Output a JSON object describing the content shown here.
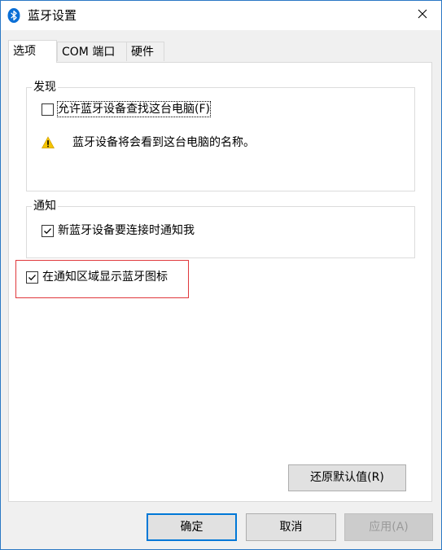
{
  "window": {
    "title": "蓝牙设置"
  },
  "tabs": [
    {
      "label": "选项",
      "active": true
    },
    {
      "label": "COM 端口",
      "active": false
    },
    {
      "label": "硬件",
      "active": false
    }
  ],
  "discovery": {
    "group_title": "发现",
    "allow_find_label": "允许蓝牙设备查找这台电脑(F)",
    "allow_find_checked": false,
    "warning_text": "蓝牙设备将会看到这台电脑的名称。"
  },
  "notifications": {
    "group_title": "通知",
    "notify_new_label": "新蓝牙设备要连接时通知我",
    "notify_new_checked": true
  },
  "show_icon": {
    "label": "在通知区域显示蓝牙图标",
    "checked": true
  },
  "buttons": {
    "restore_defaults": "还原默认值(R)",
    "ok": "确定",
    "cancel": "取消",
    "apply": "应用(A)"
  },
  "colors": {
    "accent": "#0078d7",
    "highlight": "#e0383c",
    "warning": "#f5c400"
  },
  "icons": {
    "title": "bluetooth-icon",
    "close": "close-icon",
    "warning": "warning-icon",
    "check": "check-icon"
  }
}
